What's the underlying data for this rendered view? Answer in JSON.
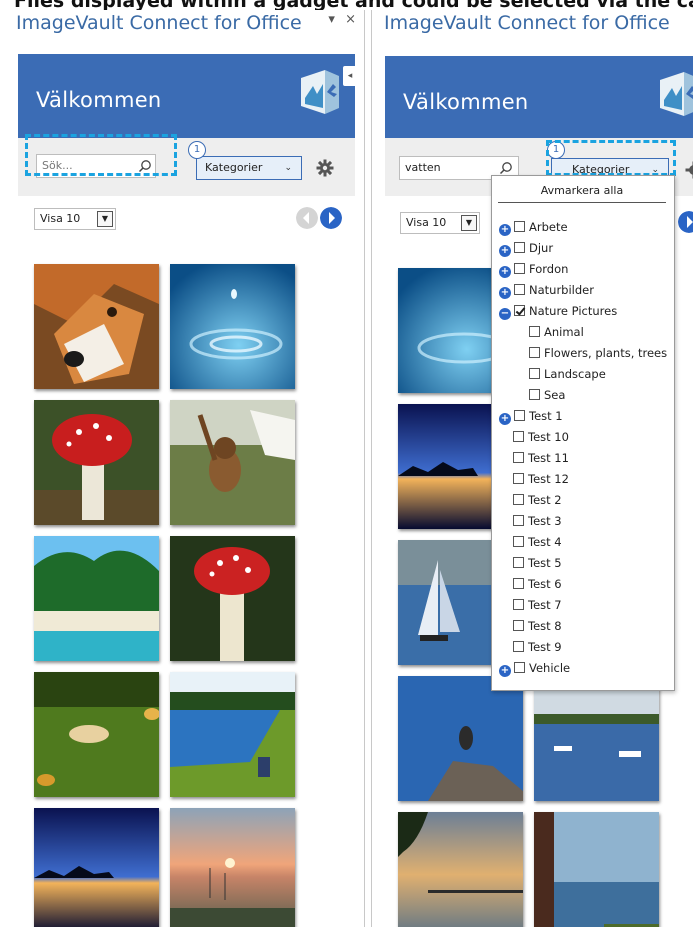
{
  "caption": "Files displayed within a gadget and could be selected via the categories",
  "panes": [
    {
      "title": "ImageVault Connect for Office",
      "welcome": "Välkommen",
      "search_placeholder": "Sök...",
      "search_value": "",
      "categories_label": "Kategorier",
      "badge": "1",
      "visa": "Visa 10",
      "window_controls": [
        "▾",
        "×"
      ]
    },
    {
      "title": "ImageVault Connect for Office",
      "welcome": "Välkommen",
      "search_value": "vatten",
      "categories_label": "Kategorier",
      "badge": "1",
      "visa": "Visa 10"
    }
  ],
  "dropdown": {
    "unselect_all": "Avmarkera alla",
    "items": [
      {
        "label": "Arbete",
        "checked": false,
        "expander": "+"
      },
      {
        "label": "Djur",
        "checked": false,
        "expander": "+"
      },
      {
        "label": "Fordon",
        "checked": false,
        "expander": "+"
      },
      {
        "label": "Naturbilder",
        "checked": false,
        "expander": "+"
      },
      {
        "label": "Nature Pictures",
        "checked": true,
        "expander": "−"
      },
      {
        "label": "Animal",
        "checked": false,
        "expander": ""
      },
      {
        "label": "Flowers, plants, trees",
        "checked": false,
        "expander": ""
      },
      {
        "label": "Landscape",
        "checked": false,
        "expander": ""
      },
      {
        "label": "Sea",
        "checked": false,
        "expander": ""
      },
      {
        "label": "Test 1",
        "checked": false,
        "expander": "+"
      },
      {
        "label": "Test 10",
        "checked": false,
        "expander": ""
      },
      {
        "label": "Test 11",
        "checked": false,
        "expander": ""
      },
      {
        "label": "Test 12",
        "checked": false,
        "expander": ""
      },
      {
        "label": "Test 2",
        "checked": false,
        "expander": ""
      },
      {
        "label": "Test 3",
        "checked": false,
        "expander": ""
      },
      {
        "label": "Test 4",
        "checked": false,
        "expander": ""
      },
      {
        "label": "Test 5",
        "checked": false,
        "expander": ""
      },
      {
        "label": "Test 6",
        "checked": false,
        "expander": ""
      },
      {
        "label": "Test 7",
        "checked": false,
        "expander": ""
      },
      {
        "label": "Test 8",
        "checked": false,
        "expander": ""
      },
      {
        "label": "Test 9",
        "checked": false,
        "expander": ""
      },
      {
        "label": "Vehicle",
        "checked": false,
        "expander": "+"
      }
    ]
  },
  "colors": {
    "banner": "#3b6cb5",
    "title_text": "#3a6aa5",
    "focus_highlight": "#1aa3e0",
    "toolbar_bg": "#eeeeee"
  },
  "thumbnails_left": [
    "fox",
    "water-drop",
    "red-mushroom",
    "monkey",
    "palm-beach",
    "red-mushroom-2",
    "meadow-mushrooms",
    "lake-fishing",
    "night-lake",
    "sunset-boats"
  ],
  "thumbnails_right": [
    "water-drop",
    "night-lake",
    "sailboat",
    "rock-bird",
    "pier-sunset",
    "harbor-window",
    "boats-bay"
  ]
}
